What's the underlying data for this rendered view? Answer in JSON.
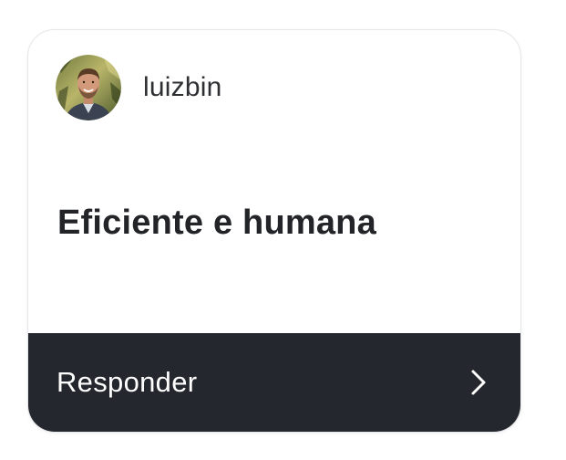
{
  "card": {
    "user": {
      "username": "luizbin",
      "avatar_icon": "user-avatar-photo"
    },
    "message": "Eficiente e humana",
    "reply": {
      "label": "Responder",
      "icon": "chevron-right-icon"
    }
  },
  "colors": {
    "reply_bar_background": "#24272d",
    "reply_text": "#ffffff",
    "message_text": "#222428",
    "username_text": "#2d2f33",
    "card_border": "#e6e7ea"
  }
}
